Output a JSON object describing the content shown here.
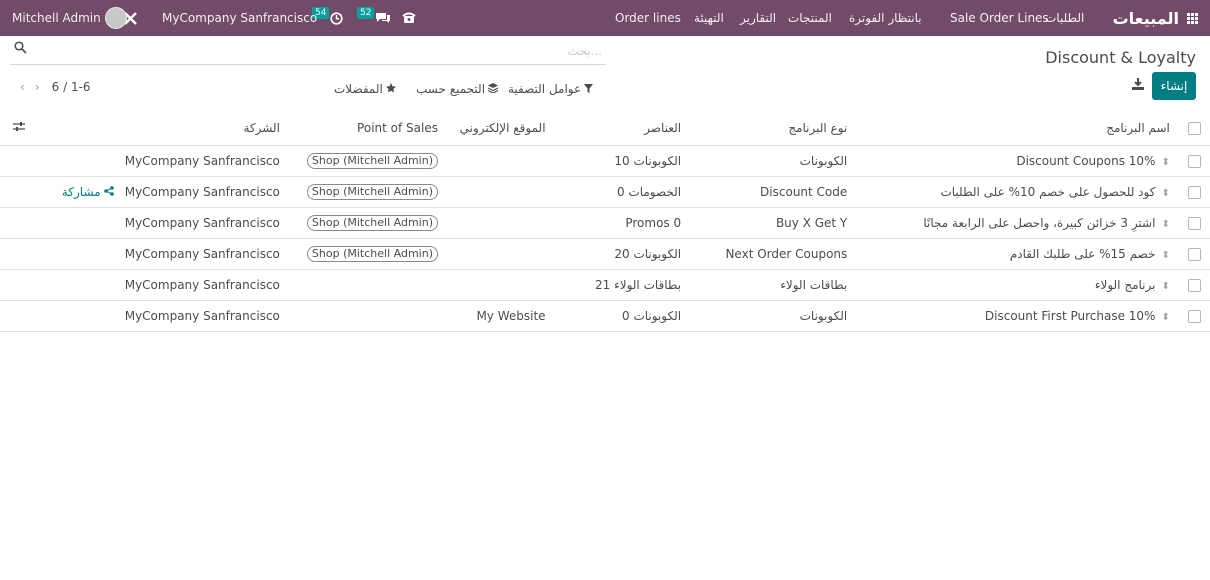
{
  "navbar": {
    "app_name": "المبيعات",
    "menus": [
      "الطلبات",
      "Sale Order Lines",
      "بانتظار الفوترة",
      "المنتجات",
      "التقارير",
      "التهيئة",
      "Order lines"
    ],
    "company": "MyCompany Sanfrancisco",
    "activity_count": "54",
    "message_count": "52",
    "user": "Mitchell Admin"
  },
  "page_title": "Discount & Loyalty",
  "search": {
    "placeholder": "بحث..."
  },
  "create_label": "إنشاء",
  "filters": {
    "filter_label": "عوامل التصفية",
    "group_label": "التجميع حسب",
    "fav_label": "المفضلات"
  },
  "pager": {
    "value": "1-6 / 6"
  },
  "columns": {
    "name": "اسم البرنامج",
    "type": "نوع البرنامج",
    "items": "العناصر",
    "website": "الموقع الإلكتروني",
    "pos": "Point of Sales",
    "company": "الشركة"
  },
  "rows": [
    {
      "name": "Discount Coupons 10%",
      "type": "الكوبونات",
      "items": "10 الكوبونات",
      "website": "",
      "pos": "Shop (Mitchell Admin)",
      "company": "MyCompany Sanfrancisco",
      "action": ""
    },
    {
      "name": "كود للحصول على خصم 10% على الطلبات",
      "type": "Discount Code",
      "items": "0 الخصومات",
      "website": "",
      "pos": "Shop (Mitchell Admin)",
      "company": "MyCompany Sanfrancisco",
      "action": "مشاركة"
    },
    {
      "name": "اشترِ 3 خزائن كبيرة، واحصل على الرابعة مجانًا",
      "type": "Buy X Get Y",
      "items": "Promos 0",
      "website": "",
      "pos": "Shop (Mitchell Admin)",
      "company": "MyCompany Sanfrancisco",
      "action": ""
    },
    {
      "name": "خصم 15% على طلبك القادم",
      "type": "Next Order Coupons",
      "items": "20 الكوبونات",
      "website": "",
      "pos": "Shop (Mitchell Admin)",
      "company": "MyCompany Sanfrancisco",
      "action": ""
    },
    {
      "name": "برنامج الولاء",
      "type": "بطاقات الولاء",
      "items": "21 بطاقات الولاء",
      "website": "",
      "pos": "",
      "company": "MyCompany Sanfrancisco",
      "action": ""
    },
    {
      "name": "Discount First Purchase 10%",
      "type": "الكوبونات",
      "items": "0 الكوبونات",
      "website": "My Website",
      "pos": "",
      "company": "MyCompany Sanfrancisco",
      "action": ""
    }
  ],
  "colors": {
    "navbar": "#714b67",
    "primary": "#017e84",
    "badge": "#00a09d"
  }
}
